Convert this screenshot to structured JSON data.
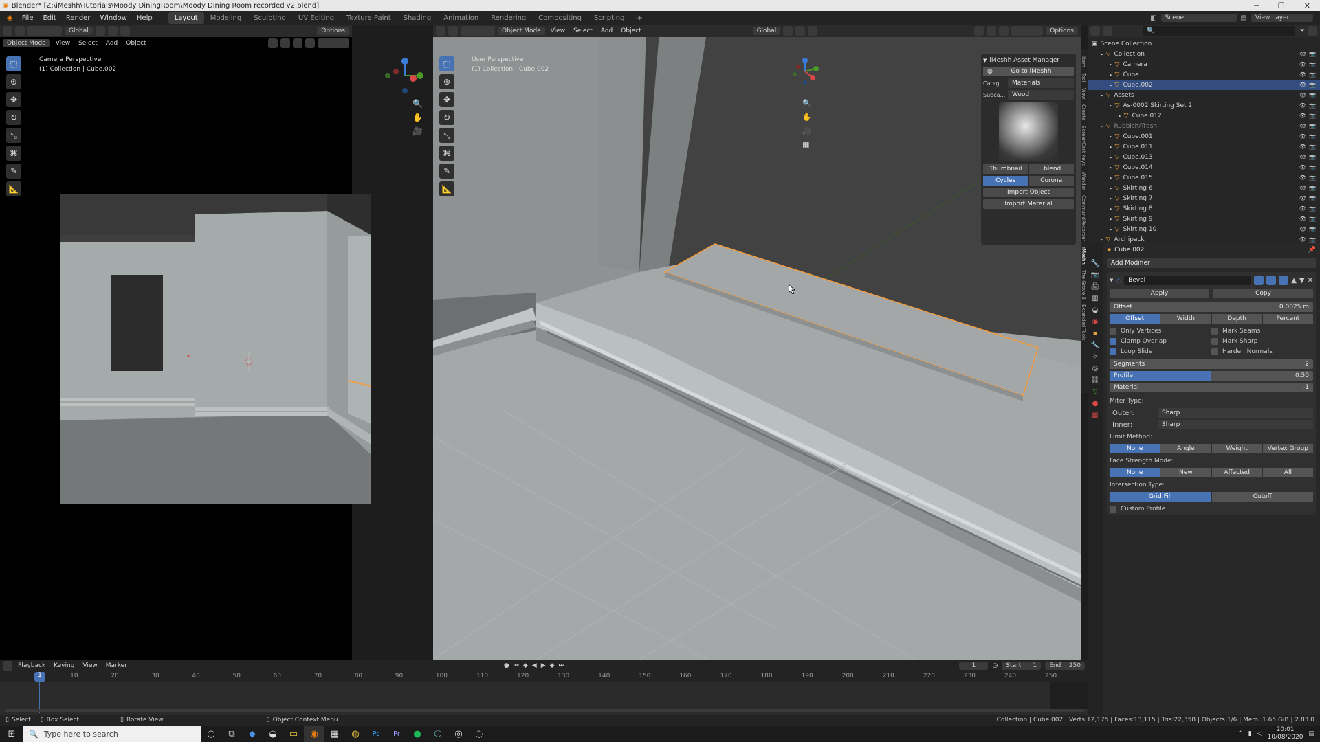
{
  "window": {
    "title": "Blender* [Z:\\iMeshh\\Tutorials\\Moody DiningRoom\\Moody Dining Room recorded v2.blend]"
  },
  "menu": [
    "File",
    "Edit",
    "Render",
    "Window",
    "Help"
  ],
  "workspaces": [
    "Layout",
    "Modeling",
    "Sculpting",
    "UV Editing",
    "Texture Paint",
    "Shading",
    "Animation",
    "Rendering",
    "Compositing",
    "Scripting"
  ],
  "active_workspace": "Layout",
  "scene": {
    "label": "Scene",
    "view_layer": "View Layer"
  },
  "left_view": {
    "mode": "Object Mode",
    "menus": [
      "View",
      "Select",
      "Add",
      "Object"
    ],
    "orientation": "Global",
    "options": "Options",
    "overlay_title": "Camera Perspective",
    "overlay_sub": "(1) Collection | Cube.002"
  },
  "main_view": {
    "mode": "Object Mode",
    "menus": [
      "View",
      "Select",
      "Add",
      "Object"
    ],
    "orientation": "Global",
    "options": "Options",
    "overlay_title": "User Perspective",
    "overlay_sub": "(1) Collection | Cube.002"
  },
  "asset_manager": {
    "title": "iMeshh Asset Manager",
    "goto": "Go to iMeshh",
    "category_label": "Categ...",
    "category_value": "Materials",
    "subcat_label": "Subca...",
    "subcat_value": "Wood",
    "thumb_btn": "Thumbnail",
    "blend_btn": ".blend",
    "engine_cycles": "Cycles",
    "engine_corona": "Corona",
    "import_object": "Import Object",
    "import_material": "Import Material"
  },
  "side_tabs": [
    "Item",
    "Tool",
    "View",
    "Create",
    "ScreenCast Keys",
    "Wander",
    "CommandRecorder",
    "iMeshh",
    "The Grove 8",
    "Extended Tools"
  ],
  "outliner": {
    "root": "Scene Collection",
    "items": [
      {
        "label": "Collection",
        "indent": 1
      },
      {
        "label": "Camera",
        "indent": 2
      },
      {
        "label": "Cube",
        "indent": 2
      },
      {
        "label": "Cube.002",
        "indent": 2,
        "selected": true
      },
      {
        "label": "Assets",
        "indent": 1
      },
      {
        "label": "As-0002 Skirting Set 2",
        "indent": 2
      },
      {
        "label": "Cube.012",
        "indent": 3
      },
      {
        "label": "Rubbish/Trash",
        "indent": 1,
        "dim": true
      },
      {
        "label": "Cube.001",
        "indent": 2
      },
      {
        "label": "Cube.011",
        "indent": 2
      },
      {
        "label": "Cube.013",
        "indent": 2
      },
      {
        "label": "Cube.014",
        "indent": 2
      },
      {
        "label": "Cube.015",
        "indent": 2
      },
      {
        "label": "Skirting 6",
        "indent": 2
      },
      {
        "label": "Skirting 7",
        "indent": 2
      },
      {
        "label": "Skirting 8",
        "indent": 2
      },
      {
        "label": "Skirting 9",
        "indent": 2
      },
      {
        "label": "Skirting 10",
        "indent": 2
      },
      {
        "label": "Archipack",
        "indent": 1
      }
    ]
  },
  "properties": {
    "object": "Cube.002",
    "add_modifier": "Add Modifier",
    "modifier_name": "Bevel",
    "apply": "Apply",
    "copy": "Copy",
    "offset_label": "Offset",
    "offset_value": "0.0025 m",
    "width_types": [
      "Offset",
      "Width",
      "Depth",
      "Percent"
    ],
    "only_vertices": "Only Vertices",
    "mark_seams": "Mark Seams",
    "clamp_overlap": "Clamp Overlap",
    "mark_sharp": "Mark Sharp",
    "loop_slide": "Loop Slide",
    "harden_normals": "Harden Normals",
    "segments_label": "Segments",
    "segments_value": "2",
    "profile_label": "Profile",
    "profile_value": "0.50",
    "profile_fill": 0.5,
    "material_label": "Material",
    "material_value": "-1",
    "miter_type": "Miter Type:",
    "outer_label": "Outer:",
    "outer_value": "Sharp",
    "inner_label": "Inner:",
    "inner_value": "Sharp",
    "limit_method": "Limit Method:",
    "limit_opts": [
      "None",
      "Angle",
      "Weight",
      "Vertex Group"
    ],
    "face_strength": "Face Strength Mode:",
    "face_opts": [
      "None",
      "New",
      "Affected",
      "All"
    ],
    "intersection": "Intersection Type:",
    "inter_opts": [
      "Grid Fill",
      "Cutoff"
    ],
    "custom_profile": "Custom Profile"
  },
  "timeline": {
    "menus": [
      "Playback",
      "Keying",
      "View",
      "Marker"
    ],
    "current_frame": "1",
    "start_label": "Start",
    "start": "1",
    "end_label": "End",
    "end": "250",
    "ticks": [
      "10",
      "20",
      "30",
      "40",
      "50",
      "60",
      "70",
      "80",
      "90",
      "100",
      "110",
      "120",
      "130",
      "140",
      "150",
      "160",
      "170",
      "180",
      "190",
      "200",
      "210",
      "220",
      "230",
      "240",
      "250"
    ]
  },
  "statusbar": {
    "select": "Select",
    "box_select": "Box Select",
    "rotate_view": "Rotate View",
    "context_menu": "Object Context Menu",
    "stats": "Collection | Cube.002 | Verts:12,175 | Faces:13,115 | Tris:22,358 | Objects:1/6 | Mem: 1.65 GiB | 2.83.0"
  },
  "taskbar": {
    "search": "Type here to search",
    "time": "20:01",
    "date": "10/08/2020"
  },
  "colors": {
    "accent": "#4772b3",
    "selection": "#f59b3c",
    "header": "#2b2b2b"
  }
}
